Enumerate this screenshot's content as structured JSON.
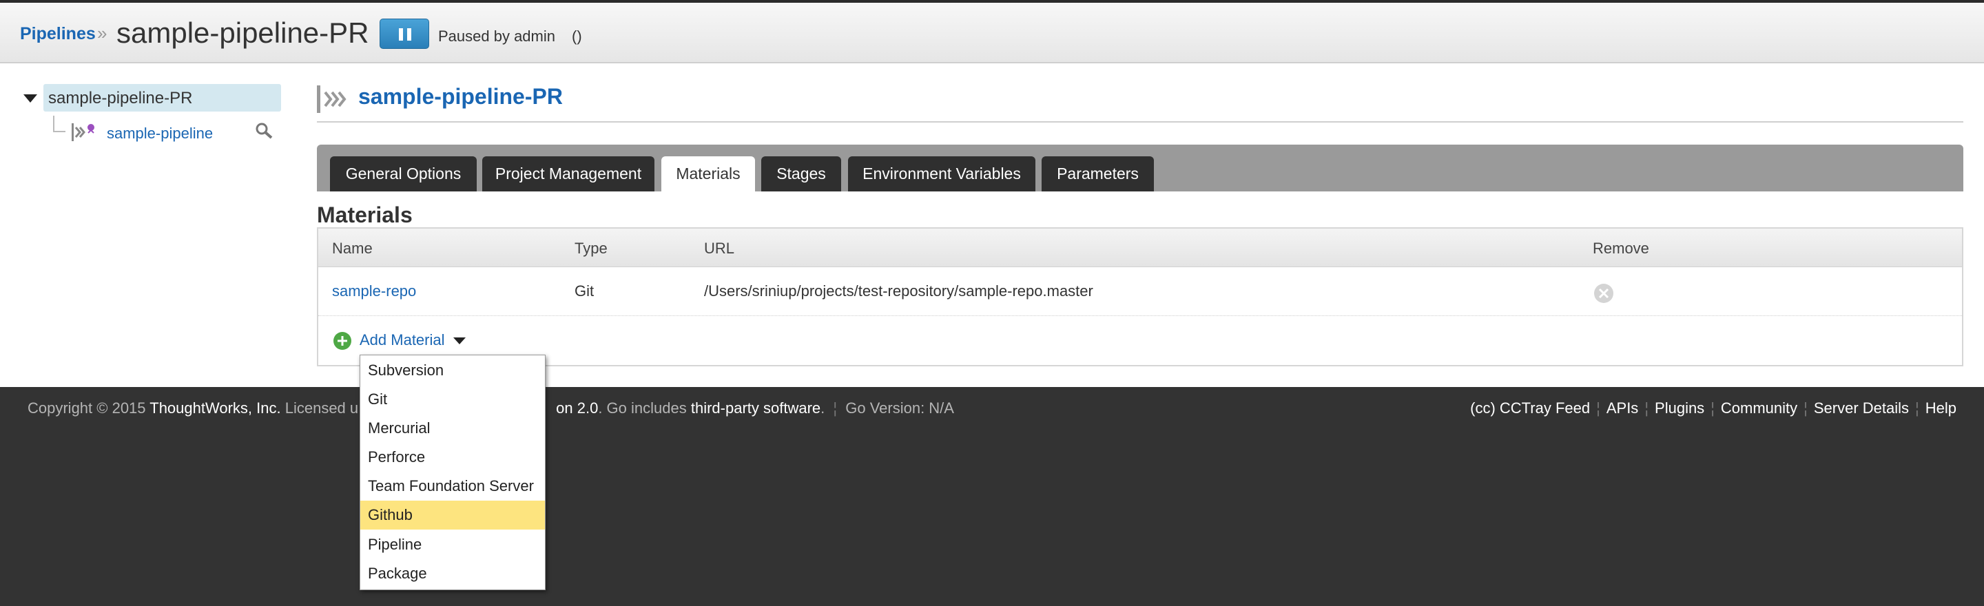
{
  "header": {
    "breadcrumb_link": "Pipelines",
    "breadcrumb_sep": "»",
    "title": "sample-pipeline-PR",
    "pause_icon": "pause-icon",
    "paused_text": "Paused by admin",
    "paused_paren": "()"
  },
  "sidebar": {
    "root_label": "sample-pipeline-PR",
    "child_label": "sample-pipeline"
  },
  "main": {
    "title": "sample-pipeline-PR",
    "tabs": [
      {
        "label": "General Options"
      },
      {
        "label": "Project Management"
      },
      {
        "label": "Materials",
        "active": true
      },
      {
        "label": "Stages"
      },
      {
        "label": "Environment Variables"
      },
      {
        "label": "Parameters"
      }
    ],
    "section_title": "Materials"
  },
  "materials": {
    "columns": [
      "Name",
      "Type",
      "URL",
      "Remove"
    ],
    "rows": [
      {
        "name": "sample-repo",
        "type": "Git",
        "url": "/Users/sriniup/projects/test-repository/sample-repo.master"
      }
    ],
    "add_label": "Add Material"
  },
  "dropdown": {
    "options": [
      "Subversion",
      "Git",
      "Mercurial",
      "Perforce",
      "Team Foundation Server",
      "Github",
      "Pipeline",
      "Package"
    ],
    "highlighted": "Github"
  },
  "footer": {
    "copyright": "Copyright © 2015",
    "company": "ThoughtWorks, Inc.",
    "licensed": "Licensed u",
    "license_tail": "on 2.0",
    "go_includes": ". Go includes",
    "third_party": "third-party software",
    "dot": ".",
    "version": "Go Version: N/A",
    "links": [
      "(cc) CCTray Feed",
      "APIs",
      "Plugins",
      "Community",
      "Server Details",
      "Help"
    ]
  },
  "colors": {
    "link": "#1a66b3",
    "tab_active_bg": "#ffffff",
    "tab_bg": "#2f2f2f",
    "tabs_bar": "#9a9a9a",
    "highlight": "#fde47f",
    "footer_bg": "#333333",
    "pause_button": "#2a7fb8"
  }
}
